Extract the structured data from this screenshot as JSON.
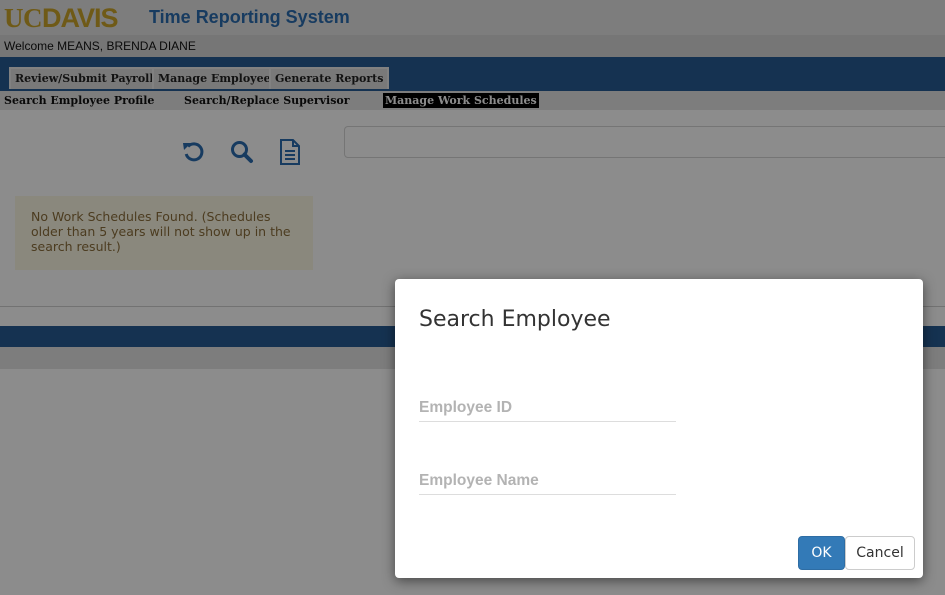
{
  "header": {
    "logo_uc": "UC",
    "logo_davis": "DAVIS",
    "app_title": "Time Reporting System",
    "welcome": "Welcome MEANS, BRENDA DIANE"
  },
  "tabs": [
    {
      "label": "Review/Submit Payroll"
    },
    {
      "label": "Manage Employee"
    },
    {
      "label": "Generate Reports"
    }
  ],
  "subnav": [
    {
      "label": "Search Employee Profile"
    },
    {
      "label": "Search/Replace Supervisor"
    },
    {
      "label": "Manage Work Schedules",
      "active": true
    }
  ],
  "toolbar": {
    "icons": [
      "undo-icon",
      "search-icon",
      "document-icon"
    ],
    "accent": "#2a6cb0"
  },
  "alert": {
    "text": "No Work Schedules Found. (Schedules older than 5 years will not show up in the search result.)"
  },
  "modal": {
    "title": "Search Employee",
    "employee_id_placeholder": "Employee ID",
    "employee_name_placeholder": "Employee Name",
    "ok_label": "OK",
    "cancel_label": "Cancel"
  },
  "colors": {
    "nav_blue": "#275c94",
    "gold": "#cba42a",
    "primary_button": "#337ab7"
  }
}
